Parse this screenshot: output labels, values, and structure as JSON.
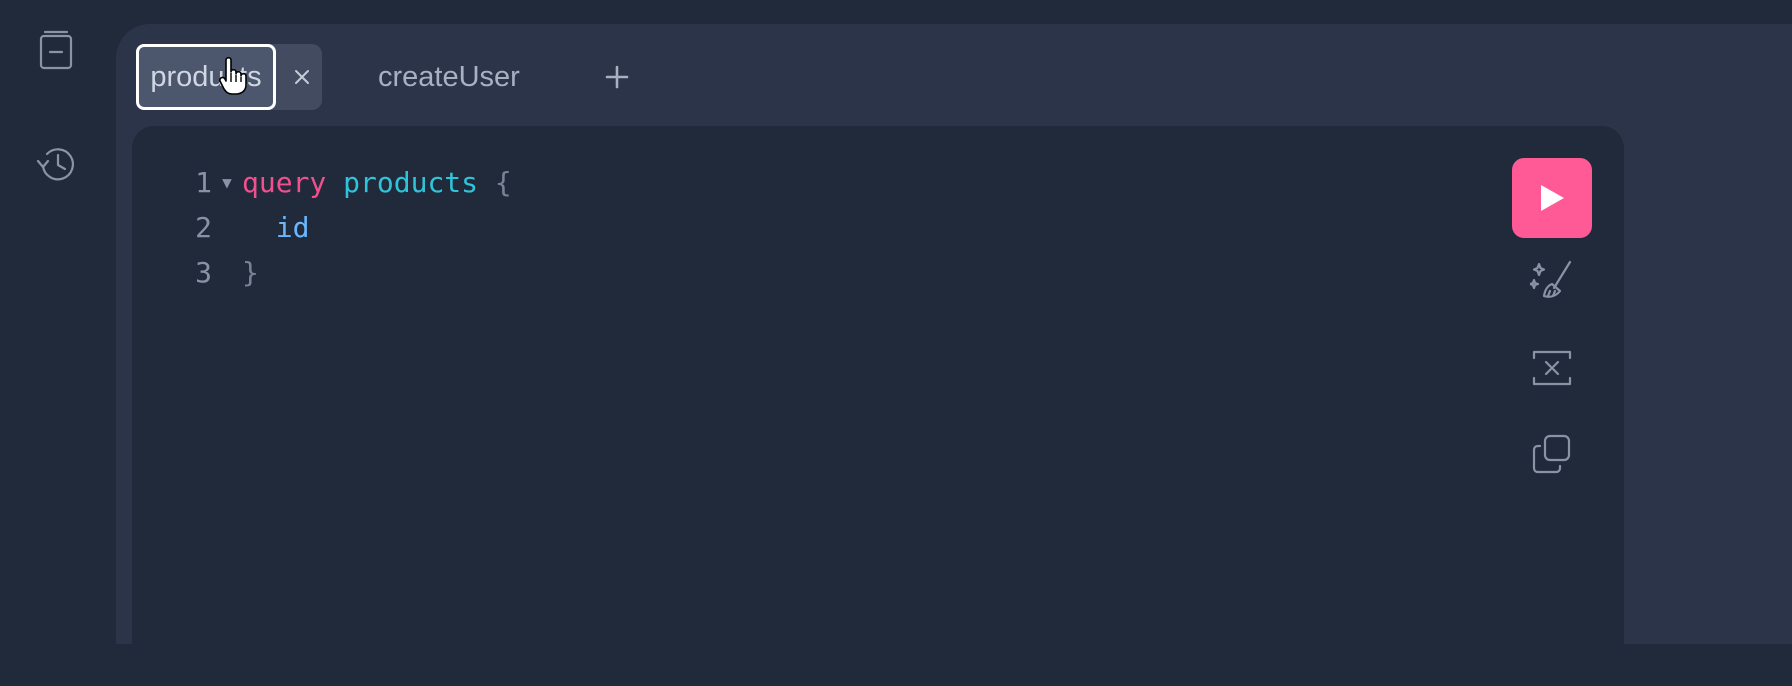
{
  "sidebar": {
    "icons": [
      "document-icon",
      "history-icon"
    ]
  },
  "tabs": [
    {
      "label": "products",
      "active": true,
      "close_label": "×"
    },
    {
      "label": "createUser",
      "active": false
    }
  ],
  "editor": {
    "lines": [
      {
        "number": "1",
        "fold": "▼",
        "keyword": "query",
        "name": "products",
        "brace": "{"
      },
      {
        "number": "2",
        "field": "id"
      },
      {
        "number": "3",
        "brace": "}"
      }
    ]
  },
  "toolbar": {
    "icons": [
      "play-icon",
      "prettify-icon",
      "merge-fragments-icon",
      "copy-icon"
    ]
  },
  "colors": {
    "accent": "#ff5a96",
    "keyword": "#f0508e",
    "name": "#2ec4d9",
    "field": "#6ab7ff"
  }
}
